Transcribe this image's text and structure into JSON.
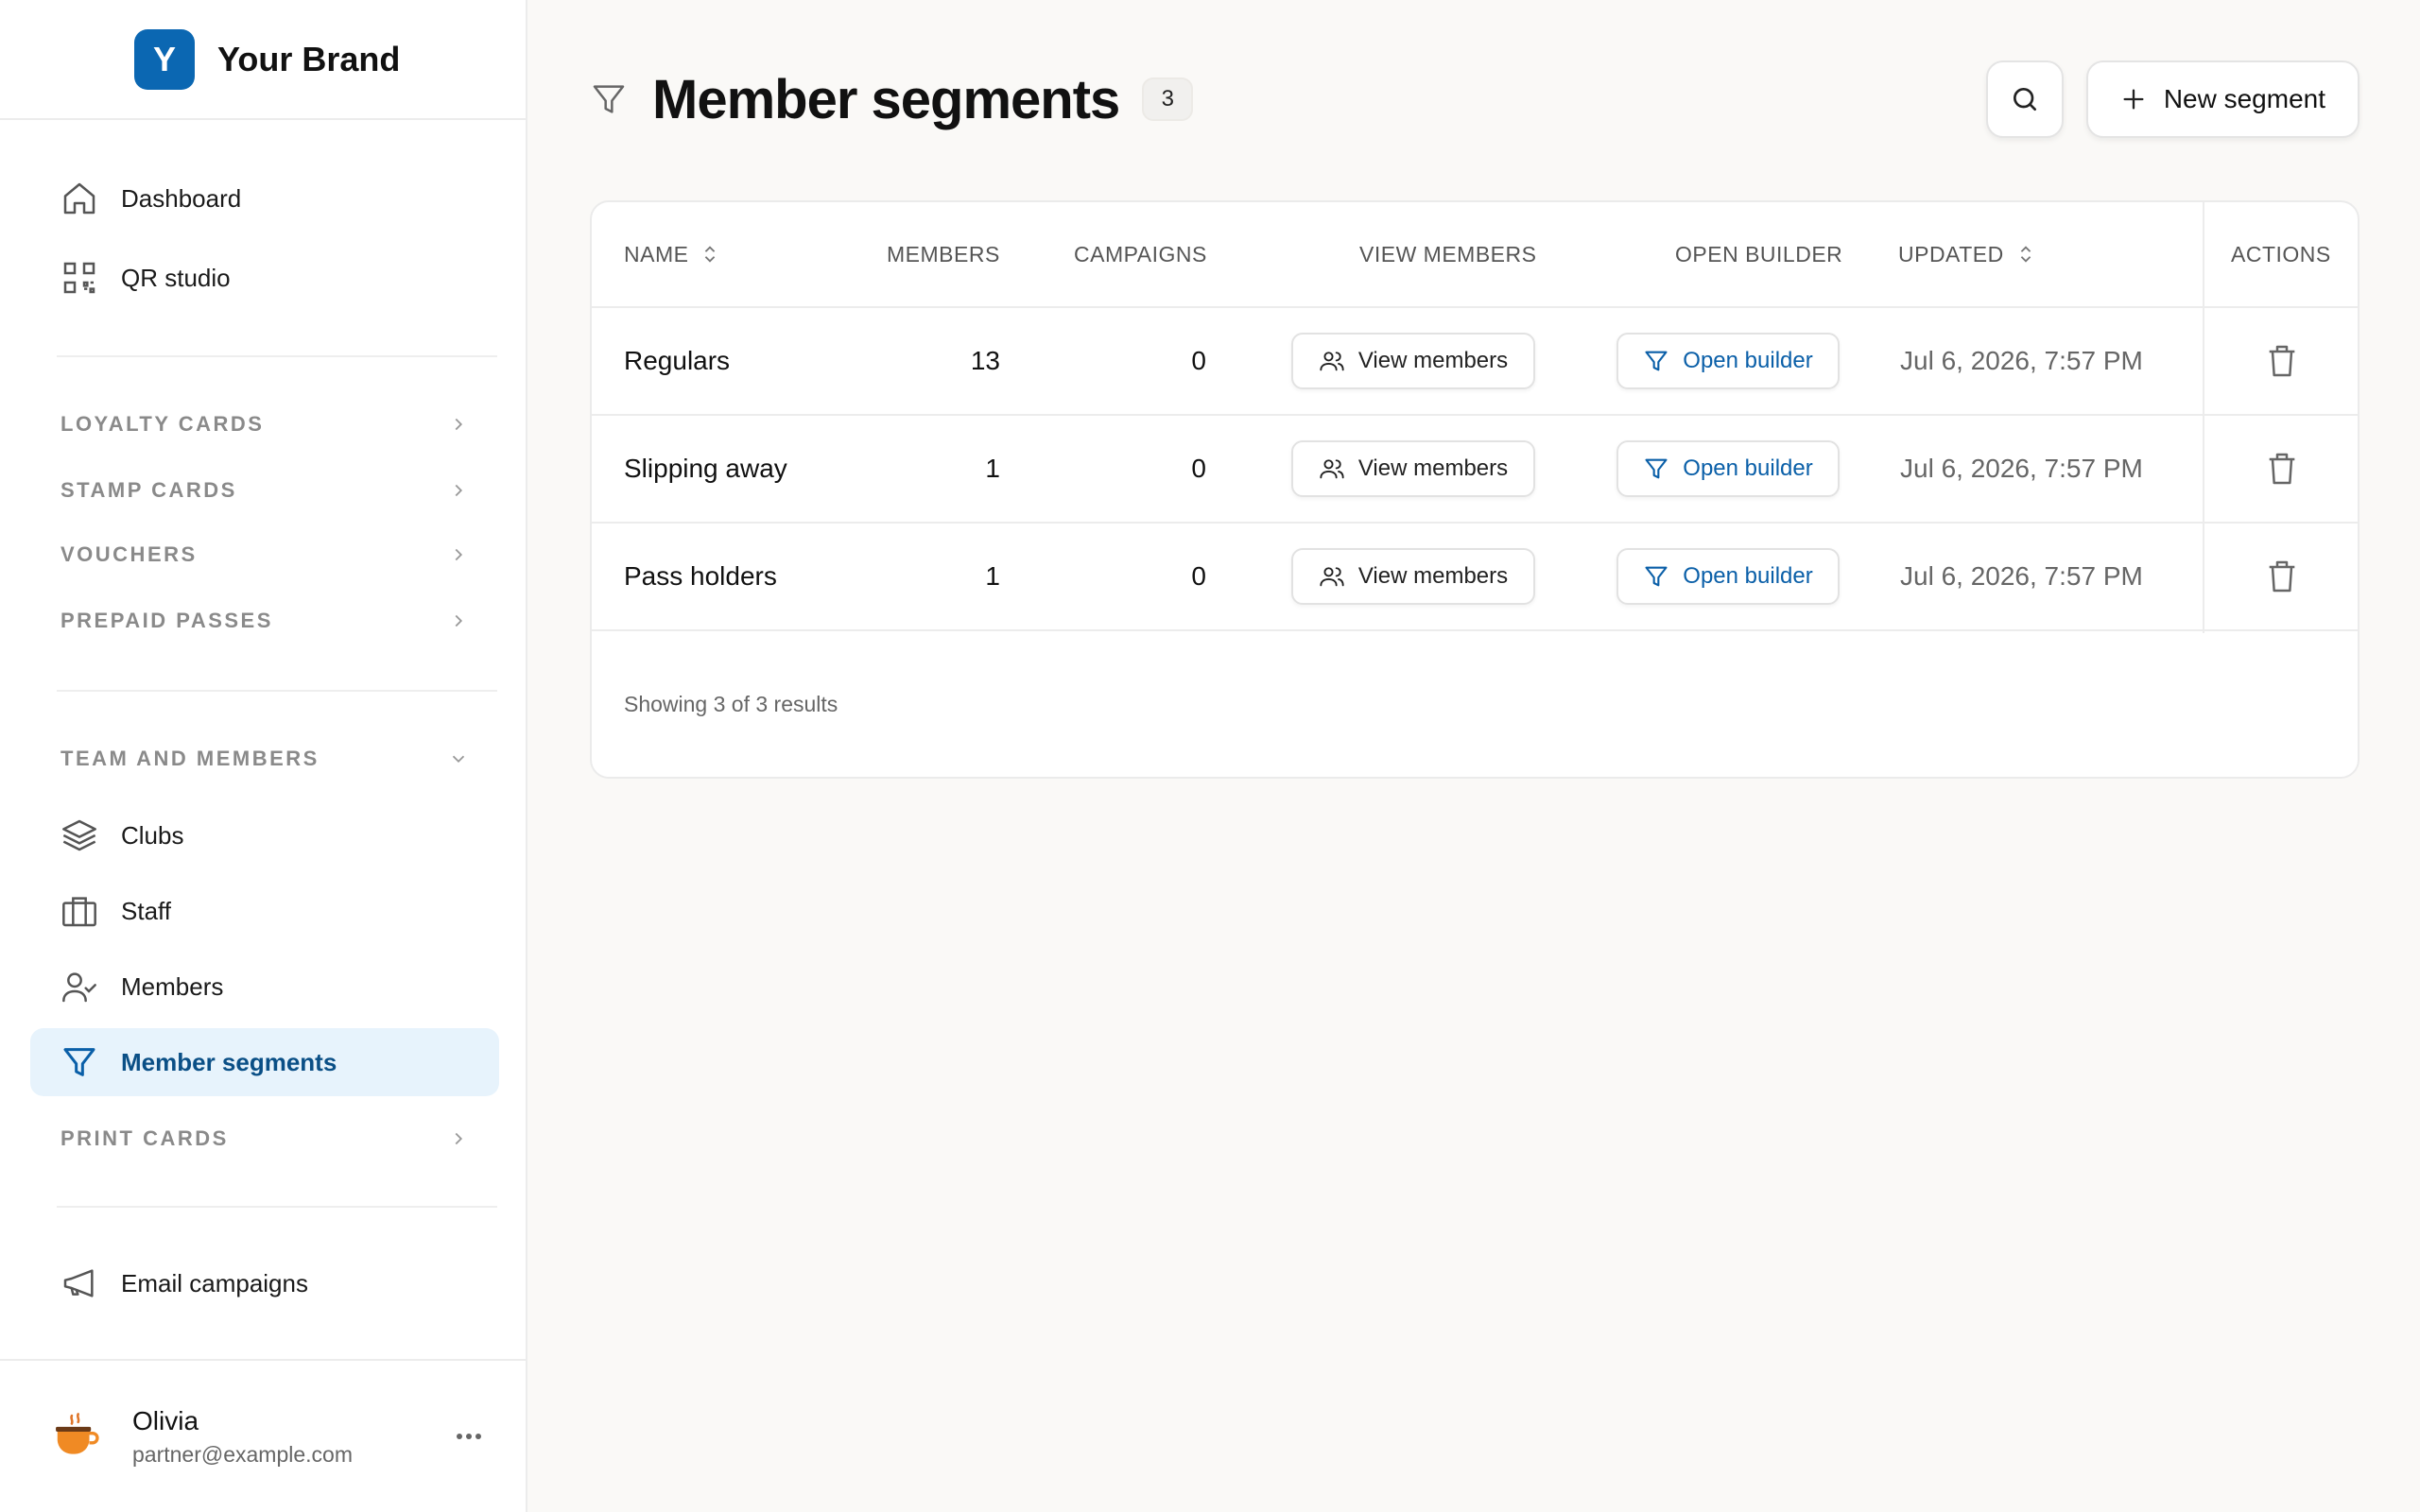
{
  "brand": {
    "logo_letter": "Y",
    "name": "Your Brand",
    "color": "#0b67b2"
  },
  "sidebar": {
    "top_items": [
      {
        "label": "Dashboard",
        "icon": "home-icon"
      },
      {
        "label": "QR studio",
        "icon": "qr-code-icon"
      }
    ],
    "groups": [
      {
        "label": "LOYALTY CARDS",
        "expanded": false
      },
      {
        "label": "STAMP CARDS",
        "expanded": false
      },
      {
        "label": "VOUCHERS",
        "expanded": false
      },
      {
        "label": "PREPAID PASSES",
        "expanded": false
      }
    ],
    "team_group": {
      "label": "TEAM AND MEMBERS",
      "expanded": true
    },
    "team_items": [
      {
        "label": "Clubs",
        "icon": "layers-icon"
      },
      {
        "label": "Staff",
        "icon": "briefcase-icon"
      },
      {
        "label": "Members",
        "icon": "user-check-icon"
      },
      {
        "label": "Member segments",
        "icon": "filter-icon",
        "active": true
      }
    ],
    "print_group": {
      "label": "PRINT CARDS",
      "expanded": false
    },
    "bottom_items": [
      {
        "label": "Email campaigns",
        "icon": "megaphone-icon"
      }
    ],
    "user": {
      "name": "Olivia",
      "email": "partner@example.com"
    }
  },
  "header": {
    "title": "Member segments",
    "count": "3",
    "new_button": "New segment"
  },
  "table": {
    "columns": {
      "name": "NAME",
      "members": "MEMBERS",
      "campaigns": "CAMPAIGNS",
      "view_members": "VIEW MEMBERS",
      "open_builder": "OPEN BUILDER",
      "updated": "UPDATED",
      "actions": "ACTIONS"
    },
    "rows": [
      {
        "name": "Regulars",
        "members": "13",
        "campaigns": "0",
        "view_label": "View members",
        "builder_label": "Open builder",
        "updated": "Jul 6, 2026, 7:57 PM"
      },
      {
        "name": "Slipping away",
        "members": "1",
        "campaigns": "0",
        "view_label": "View members",
        "builder_label": "Open builder",
        "updated": "Jul 6, 2026, 7:57 PM"
      },
      {
        "name": "Pass holders",
        "members": "1",
        "campaigns": "0",
        "view_label": "View members",
        "builder_label": "Open builder",
        "updated": "Jul 6, 2026, 7:57 PM"
      }
    ],
    "footer": "Showing 3 of 3 results"
  },
  "colors": {
    "accent": "#0a5fa8",
    "active_bg": "#e7f3fc",
    "background": "#faf9f7"
  }
}
